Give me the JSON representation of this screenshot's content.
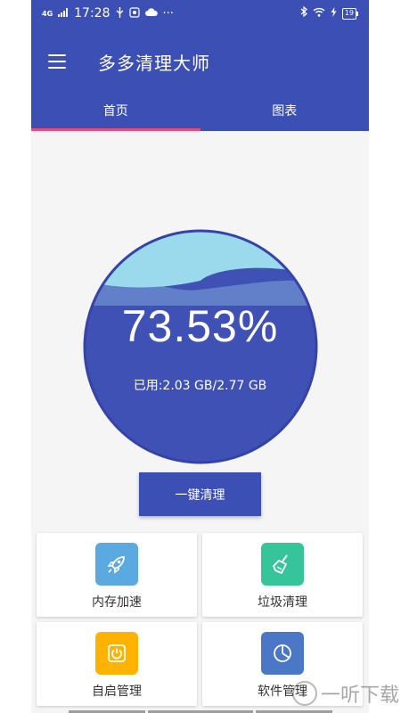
{
  "status_bar": {
    "signal": "4G",
    "time": "17:28",
    "battery": "19",
    "dots": "···"
  },
  "app_bar": {
    "title": "多多清理大师"
  },
  "tabs": [
    {
      "label": "首页",
      "active": true
    },
    {
      "label": "图表",
      "active": false
    }
  ],
  "gauge": {
    "percent_text": "73.53%",
    "used_text": "已用:2.03 GB/2.77 GB",
    "used_fraction": 0.7353,
    "colors": {
      "circle": "#3f51b5",
      "water": "#9bd9ec",
      "ring": "#3543a8"
    }
  },
  "clean_button": {
    "label": "一键清理"
  },
  "features": [
    {
      "label": "内存加速",
      "icon": "rocket-icon",
      "color": "#5aa9e0"
    },
    {
      "label": "垃圾清理",
      "icon": "broom-icon",
      "color": "#36c49a"
    },
    {
      "label": "自启管理",
      "icon": "power-icon",
      "color": "#ffb300"
    },
    {
      "label": "软件管理",
      "icon": "pie-chart-icon",
      "color": "#4a78c7"
    }
  ],
  "watermark": {
    "text": "一听下载"
  },
  "colors": {
    "primary": "#3c4fb5",
    "accent": "#e94c7a",
    "background": "#f5f5f5"
  }
}
